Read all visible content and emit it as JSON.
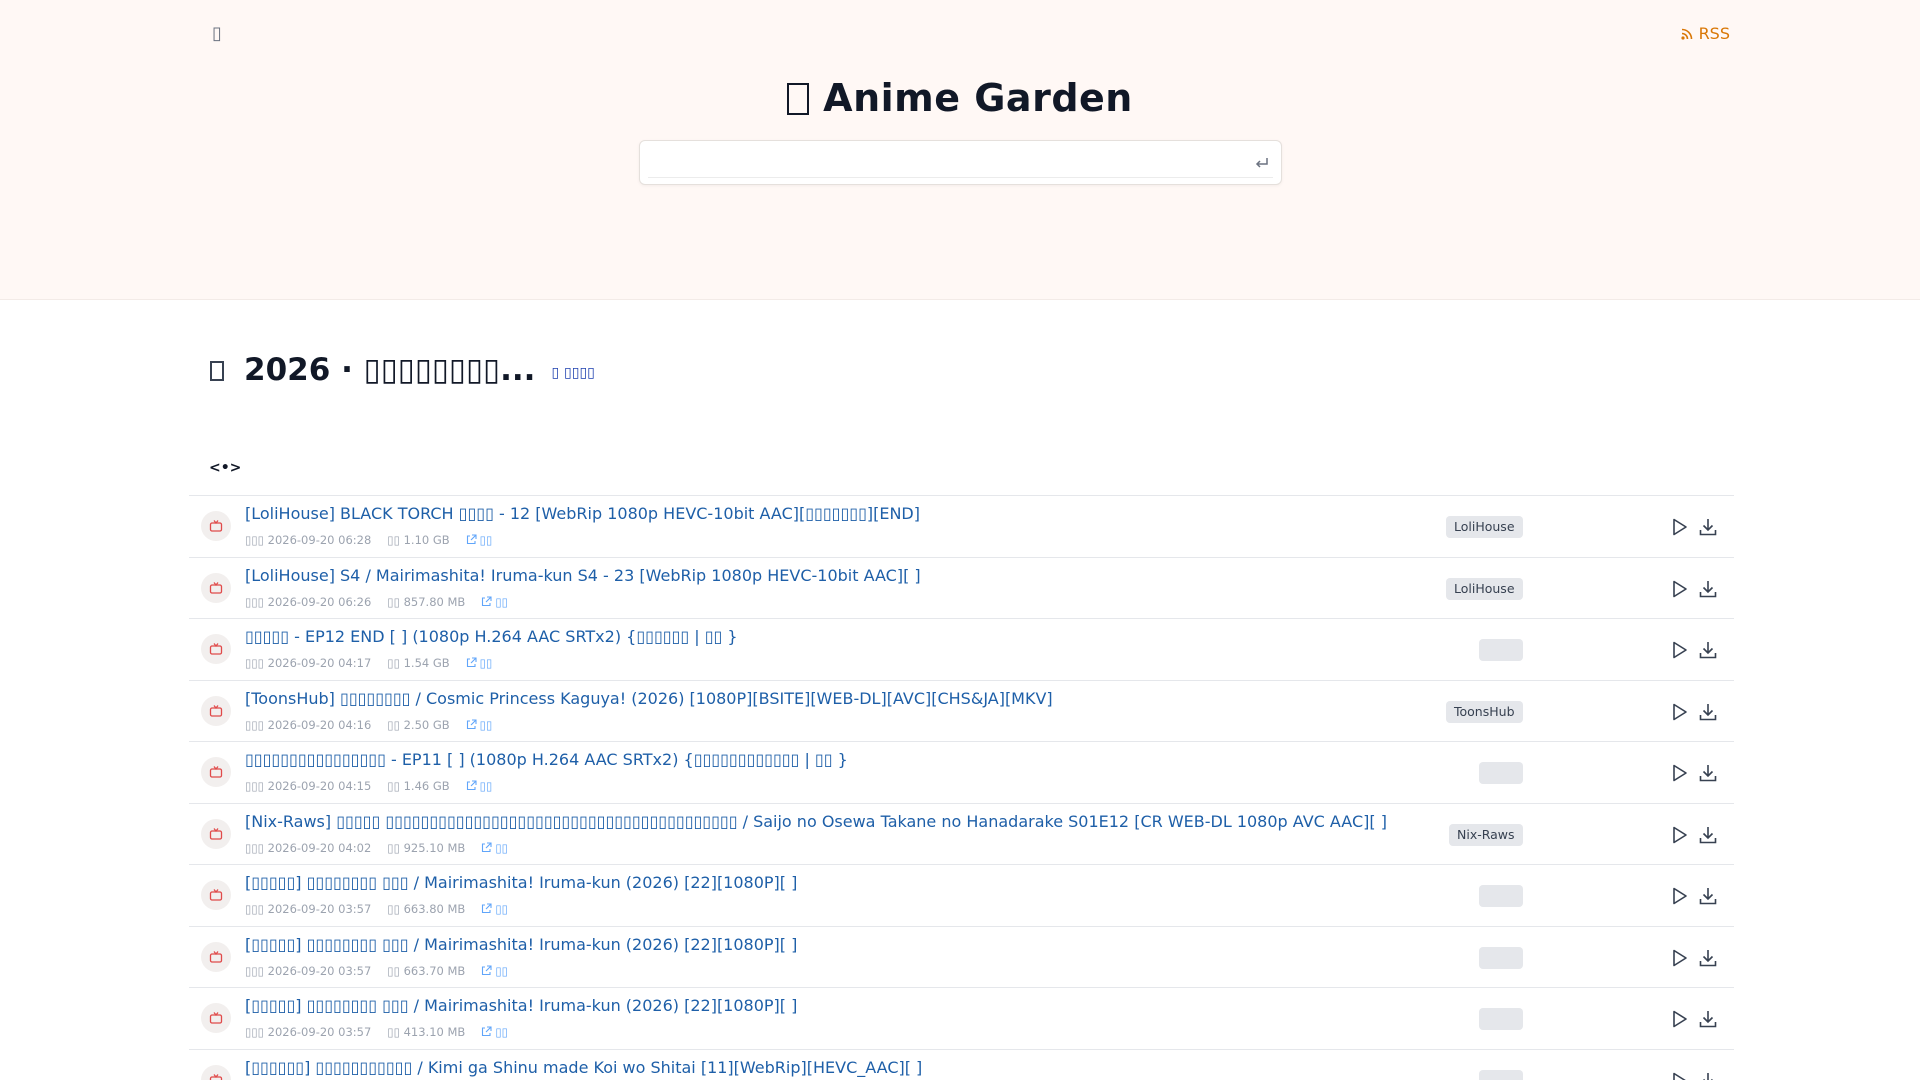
{
  "header": {
    "brand_glyph": "▯",
    "rss_label": "RSS",
    "site_title": "Anime Garden",
    "search": {
      "placeholder": "",
      "value": ""
    }
  },
  "section": {
    "title": "2026 · ▯▯▯▯▯▯▯▯...",
    "action_label": "▯ ▯▯▯▯",
    "code_toggle": "<•>"
  },
  "rows": [
    {
      "title": "[LoliHouse] BLACK TORCH ▯▯▯▯ - 12 [WebRip 1080p HEVC-10bit AAC][▯▯▯▯▯▯▯][END]",
      "date": "▯▯▯ 2026-09-20 06:28",
      "size": "▯▯ 1.10 GB",
      "link": "▯▯",
      "fansub": "LoliHouse"
    },
    {
      "title": "[LoliHouse]                     S4 / Mairimashita! Iruma-kun S4 - 23 [WebRip 1080p HEVC-10bit AAC][               ]",
      "date": "▯▯▯ 2026-09-20 06:26",
      "size": "▯▯ 857.80 MB",
      "link": "▯▯",
      "fansub": "LoliHouse"
    },
    {
      "title": "▯▯▯▯▯ - EP12 END [        ] (1080p H.264 AAC SRTx2) {▯▯▯▯▯▯ | ▯▯          }",
      "date": "▯▯▯ 2026-09-20 04:17",
      "size": "▯▯ 1.54 GB",
      "link": "▯▯",
      "fansub": ""
    },
    {
      "title": "[ToonsHub] ▯▯▯▯▯▯▯▯ / Cosmic Princess Kaguya! (2026) [1080P][BSITE][WEB-DL][AVC][CHS&JA][MKV]",
      "date": "▯▯▯ 2026-09-20 04:16",
      "size": "▯▯ 2.50 GB",
      "link": "▯▯",
      "fansub": "ToonsHub"
    },
    {
      "title": "▯▯▯▯▯▯▯▯▯▯▯▯▯▯▯▯ - EP11 [        ] (1080p H.264 AAC SRTx2) {▯▯▯▯▯▯▯▯▯▯▯▯ | ▯▯                                 }",
      "date": "▯▯▯ 2026-09-20 04:15",
      "size": "▯▯ 1.46 GB",
      "link": "▯▯",
      "fansub": ""
    },
    {
      "title": "[Nix-Raws] ▯▯▯▯▯ ▯▯▯▯▯▯▯▯▯▯▯▯▯▯▯▯▯▯▯▯▯▯▯▯▯▯▯▯▯▯▯▯▯▯▯▯▯▯▯▯ / Saijo no Osewa Takane no Hanadarake S01E12 [CR WEB-DL 1080p AVC AAC][          ]",
      "date": "▯▯▯ 2026-09-20 04:02",
      "size": "▯▯ 925.10 MB",
      "link": "▯▯",
      "fansub": "Nix-Raws"
    },
    {
      "title": "[▯▯▯▯▯] ▯▯▯▯▯▯▯▯ ▯▯▯ / Mairimashita! Iruma-kun (2026) [22][1080P][          ]",
      "date": "▯▯▯ 2026-09-20 03:57",
      "size": "▯▯ 663.80 MB",
      "link": "▯▯",
      "fansub": ""
    },
    {
      "title": "[▯▯▯▯▯] ▯▯▯▯▯▯▯▯ ▯▯▯ / Mairimashita! Iruma-kun (2026) [22][1080P][          ]",
      "date": "▯▯▯ 2026-09-20 03:57",
      "size": "▯▯ 663.70 MB",
      "link": "▯▯",
      "fansub": ""
    },
    {
      "title": "[▯▯▯▯▯] ▯▯▯▯▯▯▯▯ ▯▯▯ / Mairimashita! Iruma-kun (2026) [22][1080P][          ]",
      "date": "▯▯▯ 2026-09-20 03:57",
      "size": "▯▯ 413.10 MB",
      "link": "▯▯",
      "fansub": ""
    },
    {
      "title": "[▯▯▯▯▯▯] ▯▯▯▯▯▯▯▯▯▯▯ / Kimi ga Shinu made Koi wo Shitai [11][WebRip][HEVC_AAC][          ]",
      "date": "",
      "size": "",
      "link": "",
      "fansub": ""
    }
  ],
  "colors": {
    "accent_link": "#1e5fa8",
    "rss": "#d97706",
    "hero_bg": "#fff8f5",
    "row_icon": "#e04a4a"
  }
}
